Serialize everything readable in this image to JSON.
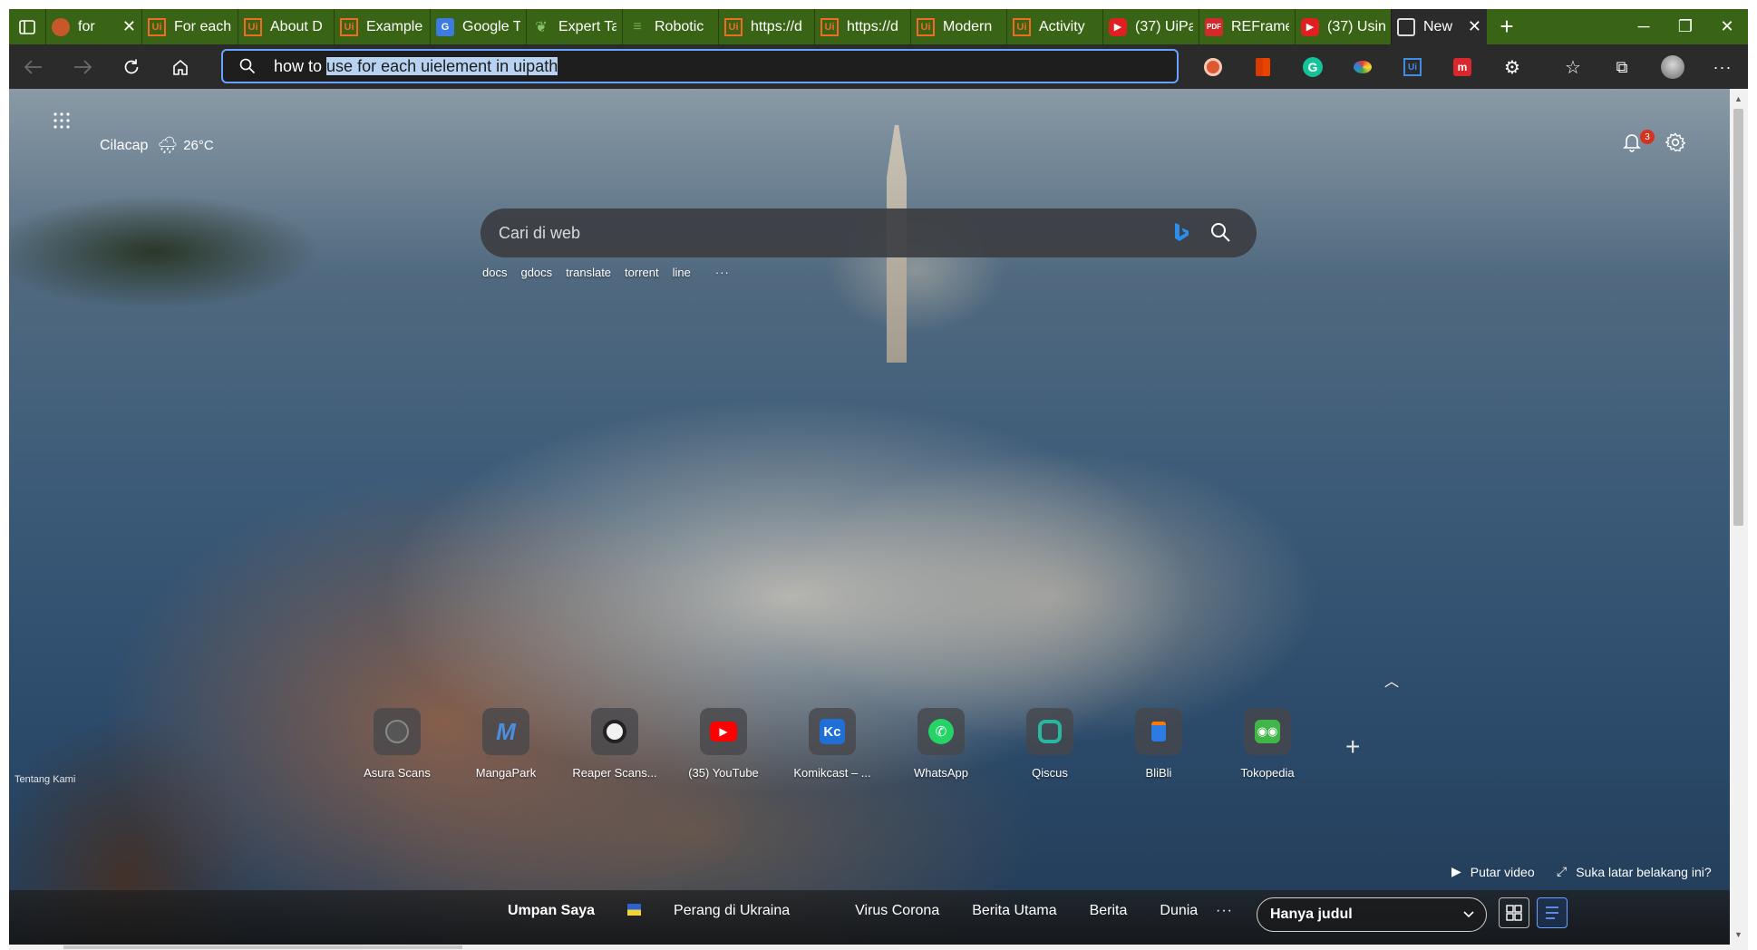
{
  "tabs": [
    {
      "title": "for",
      "icon": "circle-favicon",
      "closable": true
    },
    {
      "title": "For each",
      "icon": "uipath-favicon"
    },
    {
      "title": "About D",
      "icon": "uipath-favicon"
    },
    {
      "title": "Example",
      "icon": "uipath-favicon"
    },
    {
      "title": "Google T",
      "icon": "google-translate-favicon"
    },
    {
      "title": "Expert Ta",
      "icon": "expert-favicon"
    },
    {
      "title": "Robotic",
      "icon": "robotic-favicon"
    },
    {
      "title": "https://d",
      "icon": "uipath-favicon"
    },
    {
      "title": "https://d",
      "icon": "uipath-favicon"
    },
    {
      "title": "Modern",
      "icon": "uipath-favicon"
    },
    {
      "title": "Activity",
      "icon": "uipath-favicon"
    },
    {
      "title": "(37) UiPa",
      "icon": "youtube-favicon"
    },
    {
      "title": "REFrame",
      "icon": "pdf-favicon"
    },
    {
      "title": "(37) Usin",
      "icon": "youtube-favicon"
    },
    {
      "title": "New",
      "icon": "new-tab-favicon",
      "active": true,
      "closable": true
    }
  ],
  "address_bar": {
    "typed": "how to ",
    "suggested": "use for each uielement in uipath"
  },
  "weather": {
    "city": "Cilacap",
    "temp": "26°C"
  },
  "notifications": {
    "count": "3"
  },
  "search": {
    "placeholder": "Cari di web",
    "quick_links": [
      "docs",
      "gdocs",
      "translate",
      "torrent",
      "line"
    ],
    "more": "···"
  },
  "tiles": [
    {
      "label": "Asura Scans",
      "icon": "asura-icon"
    },
    {
      "label": "MangaPark",
      "icon": "mangapark-icon"
    },
    {
      "label": "Reaper Scans...",
      "icon": "reaper-icon"
    },
    {
      "label": "(35) YouTube",
      "icon": "youtube-icon"
    },
    {
      "label": "Komikcast – ...",
      "icon": "komikcast-icon"
    },
    {
      "label": "WhatsApp",
      "icon": "whatsapp-icon"
    },
    {
      "label": "Qiscus",
      "icon": "qiscus-icon"
    },
    {
      "label": "BliBli",
      "icon": "blibli-icon"
    },
    {
      "label": "Tokopedia",
      "icon": "tokopedia-icon"
    }
  ],
  "footer": {
    "about": "Tentang Kami",
    "play_video": "Putar video",
    "like_bg": "Suka latar belakang ini?"
  },
  "news_nav": {
    "items": [
      "Umpan Saya",
      "Perang di Ukraina",
      "Virus Corona",
      "Berita Utama",
      "Berita",
      "Dunia"
    ],
    "more": "···",
    "layout_option": "Hanya judul"
  },
  "colors": {
    "tabstrip": "#3a6415",
    "toolbar": "#2b2b2b",
    "address_focus": "#6aa3ff",
    "selection": "#b8d3f2"
  }
}
